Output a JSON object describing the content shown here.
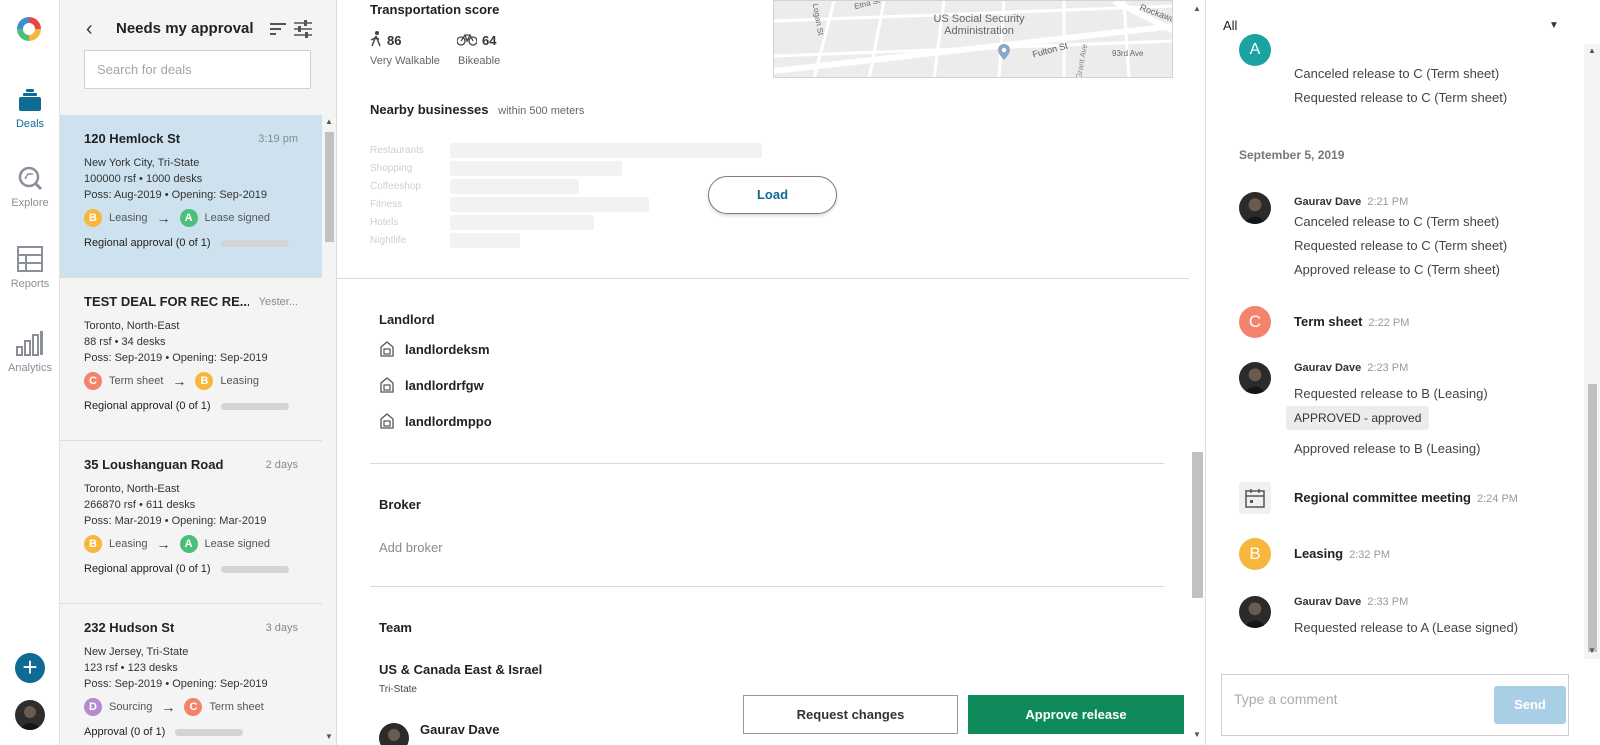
{
  "nav": {
    "items": [
      {
        "label": "Deals",
        "icon": "deals-icon",
        "active": true
      },
      {
        "label": "Explore",
        "icon": "explore-icon"
      },
      {
        "label": "Reports",
        "icon": "reports-icon"
      },
      {
        "label": "Analytics",
        "icon": "analytics-icon"
      }
    ],
    "add_label": "+"
  },
  "deal_list": {
    "title": "Needs my approval",
    "search_placeholder": "Search for deals",
    "deals": [
      {
        "name": "120 Hemlock St",
        "time": "3:19 pm",
        "location": "New York City, Tri-State",
        "size": "100000 rsf • 1000 desks",
        "dates": "Poss: Aug-2019 • Opening: Sep-2019",
        "from_badge": "B",
        "from_color": "#f6b73c",
        "from_label": "Leasing",
        "to_badge": "A",
        "to_color": "#4cbf7a",
        "to_label": "Lease signed",
        "approval": "Regional approval (0 of 1)"
      },
      {
        "name": "TEST DEAL FOR REC RE...",
        "time": "Yester...",
        "location": "Toronto, North-East",
        "size": "88 rsf • 34 desks",
        "dates": "Poss: Sep-2019 • Opening: Sep-2019",
        "from_badge": "C",
        "from_color": "#f4836b",
        "from_label": "Term sheet",
        "to_badge": "B",
        "to_color": "#f6b73c",
        "to_label": "Leasing",
        "approval": "Regional approval (0 of 1)"
      },
      {
        "name": "35 Loushanguan Road",
        "time": "2 days",
        "location": "Toronto, North-East",
        "size": "266870 rsf • 611 desks",
        "dates": "Poss: Mar-2019 • Opening: Mar-2019",
        "from_badge": "B",
        "from_color": "#f6b73c",
        "from_label": "Leasing",
        "to_badge": "A",
        "to_color": "#4cbf7a",
        "to_label": "Lease signed",
        "approval": "Regional approval (0 of 1)"
      },
      {
        "name": "232 Hudson St",
        "time": "3 days",
        "location": "New Jersey, Tri-State",
        "size": "123 rsf • 123 desks",
        "dates": "Poss: Sep-2019 • Opening: Sep-2019",
        "from_badge": "D",
        "from_color": "#b58bd0",
        "from_label": "Sourcing",
        "to_badge": "C",
        "to_color": "#f4836b",
        "to_label": "Term sheet",
        "approval": "Approval (0 of 1)"
      }
    ]
  },
  "main": {
    "transport_title": "Transportation score",
    "walk_score": "86",
    "walk_label": "Very Walkable",
    "bike_score": "64",
    "bike_label": "Bikeable",
    "map_labels": [
      "US Social Security Administration",
      "Fulton St",
      "93rd Ave",
      "Etna St",
      "Grant Ave",
      "Rockaway",
      "Logan St"
    ],
    "nearby_title": "Nearby businesses",
    "nearby_sub": "within 500 meters",
    "categories": [
      {
        "label": "Restaurants",
        "value": 0.8
      },
      {
        "label": "Shopping",
        "value": 0.44
      },
      {
        "label": "Coffeeshop",
        "value": 0.33
      },
      {
        "label": "Fitness",
        "value": 0.51
      },
      {
        "label": "Hotels",
        "value": 0.37
      },
      {
        "label": "Nightlife",
        "value": 0.18
      }
    ],
    "load_label": "Load",
    "landlord_title": "Landlord",
    "landlords": [
      "landlordeksm",
      "landlordrfgw",
      "landlordmppo"
    ],
    "broker_title": "Broker",
    "add_broker": "Add broker",
    "team_title": "Team",
    "team_region": "US & Canada East & Israel",
    "team_sub": "Tri-State",
    "team_member": "Gaurav Dave",
    "request_changes": "Request changes",
    "approve_release": "Approve release"
  },
  "activity": {
    "filter": "All",
    "date_heading": "September 5, 2019",
    "top_lines": [
      "Canceled release to C (Term sheet)",
      "Requested release to C (Term sheet)"
    ],
    "top_badge": "A",
    "events": [
      {
        "name": "Gaurav Dave",
        "time": "2:21 PM",
        "lines": [
          "Canceled release to C (Term sheet)",
          "Requested release to C (Term sheet)",
          "Approved release to C (Term sheet)"
        ]
      },
      {
        "badge": "C",
        "title": "Term sheet",
        "time": "2:22 PM",
        "color": "#f4836b"
      },
      {
        "name": "Gaurav Dave",
        "time": "2:23 PM",
        "line1": "Requested release to B (Leasing)",
        "chip": "APPROVED - approved",
        "line2": "Approved release to B (Leasing)"
      },
      {
        "title": "Regional committee meeting",
        "time": "2:24 PM",
        "icon": "calendar-icon"
      },
      {
        "badge": "B",
        "title": "Leasing",
        "time": "2:32 PM",
        "color": "#f6b73c"
      },
      {
        "name": "Gaurav Dave",
        "time": "2:33 PM",
        "line": "Requested release to A (Lease signed)"
      }
    ],
    "comment_placeholder": "Type a comment",
    "send_label": "Send"
  }
}
